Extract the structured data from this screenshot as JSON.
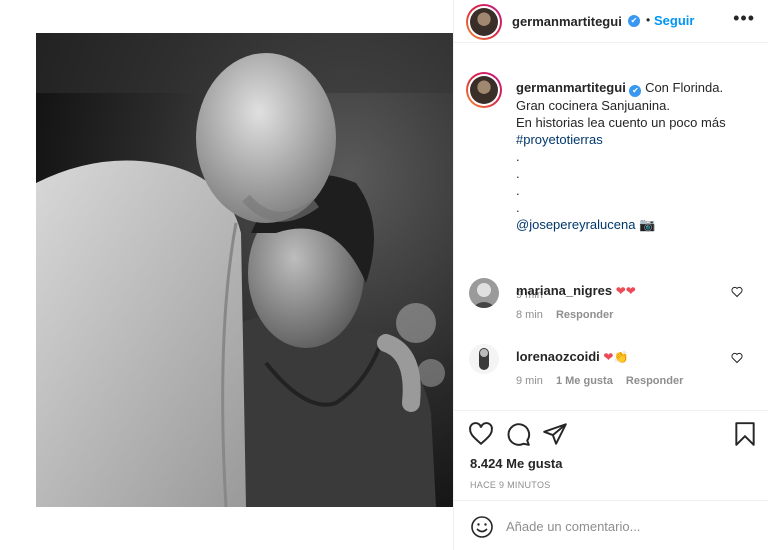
{
  "post": {
    "username": "germanmartitegui",
    "verified_mark": "✔",
    "separator": "•",
    "follow_label": "Seguir",
    "more_label": "•••"
  },
  "caption": {
    "username": "germanmartitegui",
    "lines": [
      "Con Florinda.",
      "Gran cocinera Sanjuanina.",
      "En historias lea cuento un poco más"
    ],
    "hashtag": "#proyetotierras",
    "dots": [
      ".",
      ".",
      ".",
      "."
    ],
    "mention": "@josepereyralucena",
    "mention_emoji": "📷",
    "time": "9 min"
  },
  "comments": [
    {
      "username": "mariana_nigres",
      "text": "❤❤",
      "time": "8 min",
      "likes": "",
      "reply": "Responder"
    },
    {
      "username": "lorenaozcoidi",
      "text": "❤👏",
      "time": "9 min",
      "likes": "1 Me gusta",
      "reply": "Responder"
    }
  ],
  "actions": {
    "likes": "8.424 Me gusta",
    "timestamp": "HACE 9 MINUTOS"
  },
  "add_comment": {
    "placeholder": "Añade un comentario..."
  },
  "icons": [
    "heart-icon",
    "comment-icon",
    "share-icon",
    "bookmark-icon",
    "emoji-icon"
  ]
}
